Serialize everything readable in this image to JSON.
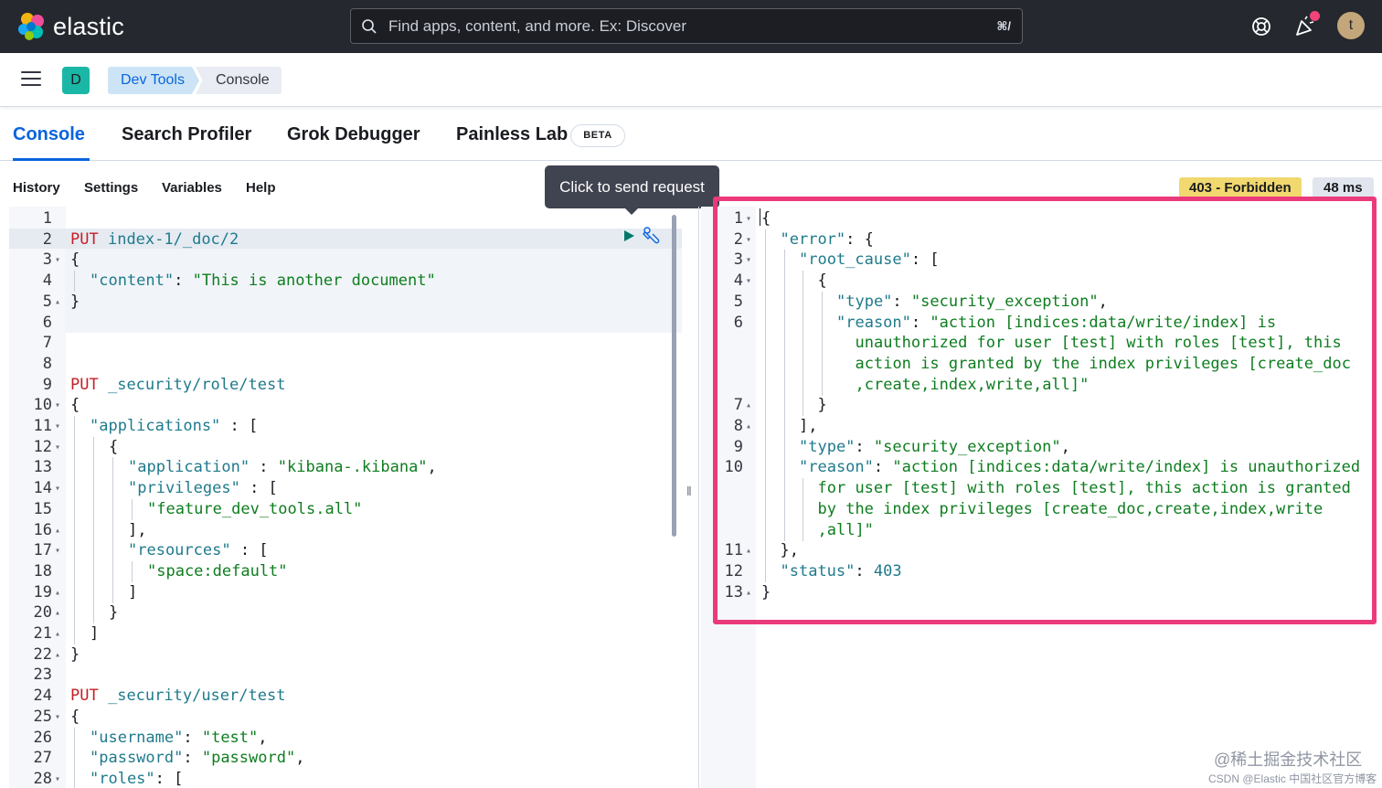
{
  "header": {
    "logo_text": "elastic",
    "search_placeholder": "Find apps, content, and more. Ex: Discover",
    "search_shortcut": "⌘/",
    "avatar_initial": "t"
  },
  "nav": {
    "space_initial": "D",
    "breadcrumbs": [
      "Dev Tools",
      "Console"
    ]
  },
  "tabs": [
    {
      "label": "Console",
      "active": true
    },
    {
      "label": "Search Profiler",
      "active": false
    },
    {
      "label": "Grok Debugger",
      "active": false
    },
    {
      "label": "Painless Lab",
      "active": false
    }
  ],
  "beta_label": "BETA",
  "console_menu": [
    "History",
    "Settings",
    "Variables",
    "Help"
  ],
  "response_status": "403 - Forbidden",
  "response_time": "48 ms",
  "tooltip": "Click to send request",
  "request_lines": [
    {
      "n": "1",
      "fold": "",
      "depth": 0,
      "text": ""
    },
    {
      "n": "2",
      "fold": "",
      "depth": 0,
      "method": "PUT",
      "path": "index-1/_doc/2"
    },
    {
      "n": "3",
      "fold": "▾",
      "depth": 0,
      "text": "{"
    },
    {
      "n": "4",
      "fold": "",
      "depth": 1,
      "key": "\"content\"",
      "sep": ": ",
      "str": "\"This is another document\""
    },
    {
      "n": "5",
      "fold": "▴",
      "depth": 0,
      "text": "}"
    },
    {
      "n": "6",
      "fold": "",
      "depth": 0,
      "text": ""
    },
    {
      "n": "7",
      "fold": "",
      "depth": 0,
      "text": ""
    },
    {
      "n": "8",
      "fold": "",
      "depth": 0,
      "text": ""
    },
    {
      "n": "9",
      "fold": "",
      "depth": 0,
      "method": "PUT",
      "path": "_security/role/test"
    },
    {
      "n": "10",
      "fold": "▾",
      "depth": 0,
      "text": "{"
    },
    {
      "n": "11",
      "fold": "▾",
      "depth": 1,
      "key": "\"applications\"",
      "sep": " : ["
    },
    {
      "n": "12",
      "fold": "▾",
      "depth": 2,
      "text": "{"
    },
    {
      "n": "13",
      "fold": "",
      "depth": 3,
      "key": "\"application\"",
      "sep": " : ",
      "str": "\"kibana-.kibana\"",
      "tail": ","
    },
    {
      "n": "14",
      "fold": "▾",
      "depth": 3,
      "key": "\"privileges\"",
      "sep": " : ["
    },
    {
      "n": "15",
      "fold": "",
      "depth": 4,
      "str": "\"feature_dev_tools.all\""
    },
    {
      "n": "16",
      "fold": "▴",
      "depth": 3,
      "text": "],"
    },
    {
      "n": "17",
      "fold": "▾",
      "depth": 3,
      "key": "\"resources\"",
      "sep": " : ["
    },
    {
      "n": "18",
      "fold": "",
      "depth": 4,
      "str": "\"space:default\""
    },
    {
      "n": "19",
      "fold": "▴",
      "depth": 3,
      "text": "]"
    },
    {
      "n": "20",
      "fold": "▴",
      "depth": 2,
      "text": "}"
    },
    {
      "n": "21",
      "fold": "▴",
      "depth": 1,
      "text": "]"
    },
    {
      "n": "22",
      "fold": "▴",
      "depth": 0,
      "text": "}"
    },
    {
      "n": "23",
      "fold": "",
      "depth": 0,
      "text": ""
    },
    {
      "n": "24",
      "fold": "",
      "depth": 0,
      "method": "PUT",
      "path": "_security/user/test"
    },
    {
      "n": "25",
      "fold": "▾",
      "depth": 0,
      "text": "{"
    },
    {
      "n": "26",
      "fold": "",
      "depth": 1,
      "key": "\"username\"",
      "sep": ": ",
      "str": "\"test\"",
      "tail": ","
    },
    {
      "n": "27",
      "fold": "",
      "depth": 1,
      "key": "\"password\"",
      "sep": ": ",
      "str": "\"password\"",
      "tail": ","
    },
    {
      "n": "28",
      "fold": "▾",
      "depth": 1,
      "key": "\"roles\"",
      "sep": ": ["
    }
  ],
  "response_lines": [
    {
      "n": "1",
      "fold": "▾",
      "depth": 0,
      "text": "{"
    },
    {
      "n": "2",
      "fold": "▾",
      "depth": 1,
      "key": "\"error\"",
      "sep": ": {"
    },
    {
      "n": "3",
      "fold": "▾",
      "depth": 2,
      "key": "\"root_cause\"",
      "sep": ": ["
    },
    {
      "n": "4",
      "fold": "▾",
      "depth": 3,
      "text": "{"
    },
    {
      "n": "5",
      "fold": "",
      "depth": 4,
      "key": "\"type\"",
      "sep": ": ",
      "str": "\"security_exception\"",
      "tail": ","
    },
    {
      "n": "6",
      "fold": "",
      "depth": 4,
      "key": "\"reason\"",
      "sep": ": ",
      "str": "\"action [indices:data/write/index] is"
    },
    {
      "n": "",
      "fold": "",
      "depth": 5,
      "str": "unauthorized for user [test] with roles [test], this"
    },
    {
      "n": "",
      "fold": "",
      "depth": 5,
      "str": "action is granted by the index privileges [create_doc"
    },
    {
      "n": "",
      "fold": "",
      "depth": 5,
      "str": ",create,index,write,all]\""
    },
    {
      "n": "7",
      "fold": "▴",
      "depth": 3,
      "text": "}"
    },
    {
      "n": "8",
      "fold": "▴",
      "depth": 2,
      "text": "],"
    },
    {
      "n": "9",
      "fold": "",
      "depth": 2,
      "key": "\"type\"",
      "sep": ": ",
      "str": "\"security_exception\"",
      "tail": ","
    },
    {
      "n": "10",
      "fold": "",
      "depth": 2,
      "key": "\"reason\"",
      "sep": ": ",
      "str": "\"action [indices:data/write/index] is unauthorized"
    },
    {
      "n": "",
      "fold": "",
      "depth": 3,
      "str": "for user [test] with roles [test], this action is granted"
    },
    {
      "n": "",
      "fold": "",
      "depth": 3,
      "str": "by the index privileges [create_doc,create,index,write"
    },
    {
      "n": "",
      "fold": "",
      "depth": 3,
      "str": ",all]\""
    },
    {
      "n": "11",
      "fold": "▴",
      "depth": 1,
      "text": "},"
    },
    {
      "n": "12",
      "fold": "",
      "depth": 1,
      "key": "\"status\"",
      "sep": ": ",
      "num": "403"
    },
    {
      "n": "13",
      "fold": "▴",
      "depth": 0,
      "text": "}"
    }
  ],
  "watermark": "@稀土掘金技术社区",
  "watermark_small": "CSDN @Elastic 中国社区官方博客",
  "colors": {
    "header_bg": "#25282f",
    "accent": "#0b64dd",
    "status_forbidden": "#f1d86f",
    "highlight_frame": "#eb3a7b"
  }
}
